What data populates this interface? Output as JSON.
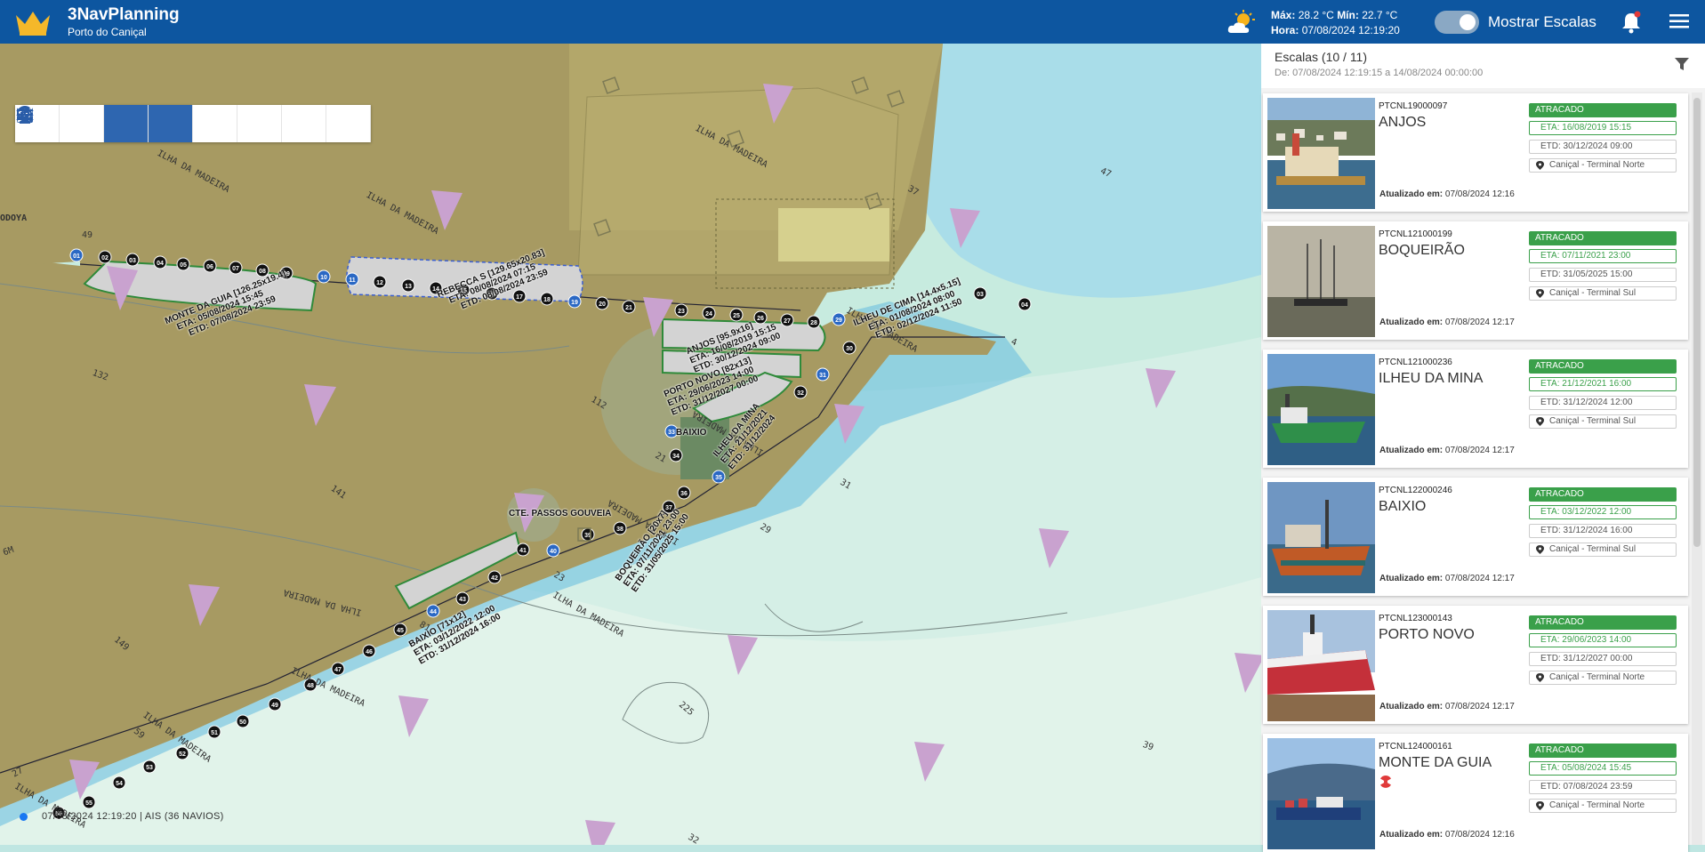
{
  "app": {
    "title": "3NavPlanning",
    "subtitle": "Porto do Caniçal"
  },
  "weather": {
    "max_label": "Máx:",
    "max_value": "28.2 °C",
    "min_label": "Mín:",
    "min_value": "22.7 °C",
    "time_label": "Hora:",
    "time_value": "07/08/2024 12:19:20",
    "icon": "sun-cloud-icon"
  },
  "header": {
    "toggle_label": "Mostrar Escalas",
    "toggle_on": true
  },
  "toolbar": {
    "items": [
      "map-pin",
      "calendar",
      "tools",
      "layers",
      "history",
      "sliders",
      "waves",
      "search-zoom"
    ],
    "active": [
      "tools",
      "layers"
    ]
  },
  "status": {
    "text": "07/08/2024 12:19:20 | AIS (36 NAVIOS)"
  },
  "panel": {
    "title": "Escalas (10 / 11)",
    "range": "De: 07/08/2024 12:19:15 a 14/08/2024 00:00:00"
  },
  "calls": [
    {
      "code": "PTCNL19000097",
      "name": "ANJOS",
      "status": "ATRACADO",
      "eta": "ETA: 16/08/2019 15:15",
      "etd": "ETD: 30/12/2024 09:00",
      "terminal": "Caniçal - Terminal Norte",
      "updated_label": "Atualizado em:",
      "updated": "07/08/2024 12:16"
    },
    {
      "code": "PTCNL121000199",
      "name": "BOQUEIRÃO",
      "status": "ATRACADO",
      "eta": "ETA: 07/11/2021 23:00",
      "etd": "ETD: 31/05/2025 15:00",
      "terminal": "Caniçal - Terminal Sul",
      "updated_label": "Atualizado em:",
      "updated": "07/08/2024 12:17"
    },
    {
      "code": "PTCNL121000236",
      "name": "ILHEU DA MINA",
      "status": "ATRACADO",
      "eta": "ETA: 21/12/2021 16:00",
      "etd": "ETD: 31/12/2024 12:00",
      "terminal": "Caniçal - Terminal Sul",
      "updated_label": "Atualizado em:",
      "updated": "07/08/2024 12:17"
    },
    {
      "code": "PTCNL122000246",
      "name": "BAIXIO",
      "status": "ATRACADO",
      "eta": "ETA: 03/12/2022 12:00",
      "etd": "ETD: 31/12/2024 16:00",
      "terminal": "Caniçal - Terminal Sul",
      "updated_label": "Atualizado em:",
      "updated": "07/08/2024 12:17"
    },
    {
      "code": "PTCNL123000143",
      "name": "PORTO NOVO",
      "status": "ATRACADO",
      "eta": "ETA: 29/06/2023 14:00",
      "etd": "ETD: 31/12/2027 00:00",
      "terminal": "Caniçal - Terminal Norte",
      "updated_label": "Atualizado em:",
      "updated": "07/08/2024 12:17"
    },
    {
      "code": "PTCNL124000161",
      "name": "MONTE DA GUIA",
      "status": "ATRACADO",
      "eta": "ETA: 05/08/2024 15:45",
      "etd": "ETD: 07/08/2024 23:59",
      "terminal": "Caniçal - Terminal Norte",
      "updated_label": "Atualizado em:",
      "updated": "07/08/2024 12:16"
    }
  ],
  "map": {
    "ships": [
      {
        "l1": "MONTE DA GUIA [126.25x19.4]",
        "l2": "ETA: 05/08/2024 15:45",
        "l3": "ETD: 07/08/2024 23:59"
      },
      {
        "l1": "REBECCA S [129.65x20.83]",
        "l2": "ETA: 08/08/2024 07:15",
        "l3": "ETD: 08/08/2024 23:59"
      },
      {
        "l1": "ANJOS [95.9x16]",
        "l2": "ETA: 16/08/2019 15:15",
        "l3": "ETD: 30/12/2024 09:00"
      },
      {
        "l1": "PORTO NOVO [82x13]",
        "l2": "ETA: 29/06/2023 14:00",
        "l3": "ETD: 31/12/2027 00:00"
      },
      {
        "l1": "ILHEU DE CIMA [14.4x5.15]",
        "l2": "ETA: 01/08/2024 08:00",
        "l3": "ETD: 02/12/2024 11:50"
      },
      {
        "l1": "BAIXIO"
      },
      {
        "l1": "ILHEU DA MINA",
        "l2": "ETA: 21/12/2021",
        "l3": "ETD: 31/12/2024"
      },
      {
        "l1": "BOQUEIRÃO [20x7]",
        "l2": "ETA: 07/11/2021 23:00",
        "l3": "ETD: 31/05/2025 15:00"
      },
      {
        "l1": "BAIXIO [71x12]",
        "l2": "ETA: 03/12/2022 12:00",
        "l3": "ETD: 31/12/2024 16:00"
      }
    ],
    "places": [
      "ILHA DA MADEIRA",
      "ILHA DA MADEIRA",
      "ILHA DA MADEIRA",
      "ILHA DA MADEIRA",
      "ILHA DA MADEIRA",
      "ILHA DA MADEIRA",
      "ILHA DA MADEIRA",
      "ILHA DA MADEIRA",
      "ILHA DA MADEIRA",
      "ILHA DA MADEIRA",
      "ILHA DA MADEIRA"
    ],
    "poi": "CTE. PASSOS GOUVEIA",
    "edge_label": "ODOYA",
    "depths": [
      "49",
      "132",
      "112",
      "141",
      "149",
      "225",
      "23",
      "29",
      "31",
      "59",
      "81",
      "21",
      "27",
      "47",
      "37",
      "39",
      "32",
      "6M",
      "4"
    ],
    "bollards": [
      "01",
      "02",
      "03",
      "04",
      "05",
      "06",
      "07",
      "08",
      "09",
      "10",
      "11",
      "12",
      "13",
      "14",
      "15",
      "16",
      "17",
      "18",
      "19",
      "20",
      "21",
      "22",
      "23",
      "24",
      "25",
      "26",
      "27",
      "28",
      "29",
      "30",
      "31",
      "32",
      "33",
      "34",
      "35",
      "36",
      "37",
      "38",
      "39",
      "40",
      "41",
      "42",
      "43",
      "44",
      "45",
      "46",
      "47",
      "48",
      "49",
      "50",
      "51",
      "52",
      "53",
      "54",
      "55",
      "56",
      "03",
      "04"
    ]
  }
}
